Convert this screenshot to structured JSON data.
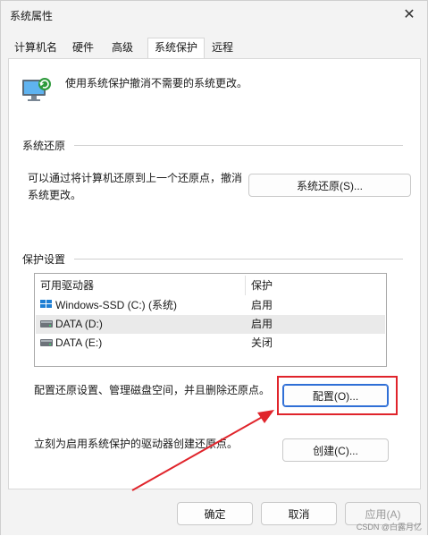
{
  "window": {
    "title": "系统属性",
    "close_symbol": "✕"
  },
  "tabs": [
    {
      "label": "计算机名",
      "active": false
    },
    {
      "label": "硬件",
      "active": false
    },
    {
      "label": "高级",
      "active": false
    },
    {
      "label": "系统保护",
      "active": true
    },
    {
      "label": "远程",
      "active": false
    }
  ],
  "intro": {
    "text": "使用系统保护撤消不需要的系统更改。",
    "icon": "computer-restore-icon"
  },
  "restore": {
    "heading": "系统还原",
    "description_line1": "可以通过将计算机还原到上一个还原点，撤消",
    "description_line2": "系统更改。",
    "button": "系统还原(S)..."
  },
  "protection": {
    "heading": "保护设置",
    "columns": [
      "可用驱动器",
      "保护"
    ],
    "drives": [
      {
        "name": "Windows-SSD (C:) (系统)",
        "status": "启用",
        "icon": "windows-drive-icon",
        "selected": false
      },
      {
        "name": "DATA (D:)",
        "status": "启用",
        "icon": "drive-icon",
        "selected": true
      },
      {
        "name": "DATA (E:)",
        "status": "关闭",
        "icon": "drive-icon",
        "selected": false
      }
    ],
    "configure_text": "配置还原设置、管理磁盘空间，并且删除还原点。",
    "configure_button": "配置(O)...",
    "create_text": "立刻为启用系统保护的驱动器创建还原点。",
    "create_button": "创建(C)..."
  },
  "footer": {
    "ok": "确定",
    "cancel": "取消",
    "apply": "应用(A)"
  },
  "watermark": "CSDN @白露月亿",
  "colors": {
    "highlight_box": "#e0242b",
    "arrow": "#e0242b",
    "focus": "#2f6fd6"
  }
}
